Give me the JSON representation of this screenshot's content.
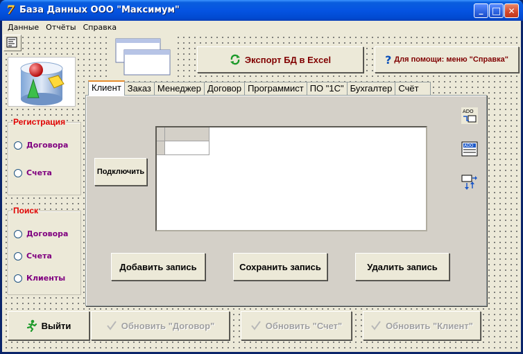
{
  "window": {
    "title": "База Данных ООО \"Максимум\"",
    "app_icon_glyph": "7",
    "minimize_glyph": "_",
    "maximize_glyph": "□",
    "close_glyph": "✕"
  },
  "menu": [
    {
      "label": "Данные"
    },
    {
      "label": "Отчёты"
    },
    {
      "label": "Справка"
    }
  ],
  "toolbar": {
    "export_label": "Экспорт БД в Excel",
    "help_label": "Для помощи: меню \"Справка\""
  },
  "registration": {
    "title": "Регистрация",
    "options": [
      "Договора",
      "Счета"
    ]
  },
  "search": {
    "title": "Поиск",
    "options": [
      "Договора",
      "Счета",
      "Клиенты"
    ]
  },
  "tabs": [
    {
      "label": "Клиент",
      "active": true
    },
    {
      "label": "Заказ"
    },
    {
      "label": "Менеджер"
    },
    {
      "label": "Договор"
    },
    {
      "label": "Программист"
    },
    {
      "label": "ПО \"1С\""
    },
    {
      "label": "Бухгалтер"
    },
    {
      "label": "Счёт"
    }
  ],
  "panel": {
    "connect_label": "Подключить",
    "add_label": "Добавить запись",
    "save_label": "Сохранить запись",
    "delete_label": "Удалить запись",
    "ado_text": "ADO"
  },
  "bottom": {
    "exit_label": "Выйти",
    "update_contract_label": "Обновить \"Договор\"",
    "update_invoice_label": "Обновить \"Счет\"",
    "update_client_label": "Обновить \"Клиент\""
  },
  "colors": {
    "group_title": "#e00000",
    "radio_label": "#800080",
    "export_text": "#800000",
    "help_text": "#800000",
    "disabled_text": "#a0a0a0"
  }
}
